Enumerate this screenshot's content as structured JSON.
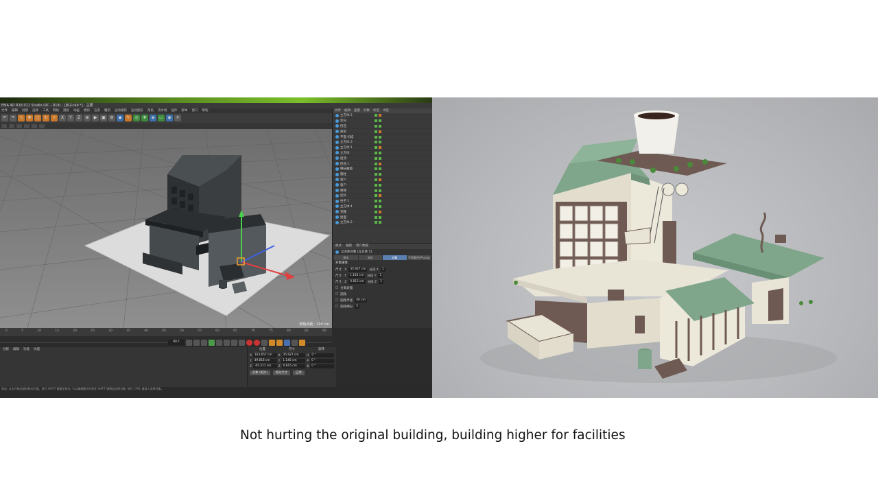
{
  "caption": "Not hurting the original building, building higher for facilities",
  "left_photo": {
    "window_title": "EMA 4D R18.011 Studio (RC - R18) - [房子c4d *] - 主要",
    "menu_items": [
      "文件",
      "编辑",
      "创建",
      "选择",
      "工具",
      "网格",
      "捕捉",
      "动画",
      "模拟",
      "渲染",
      "雕刻",
      "运动跟踪",
      "运动图形",
      "角色",
      "流水线",
      "插件",
      "脚本",
      "窗口",
      "帮助"
    ],
    "object_manager_tabs": [
      "文件",
      "编辑",
      "查看",
      "对象",
      "标签",
      "书签"
    ],
    "objects": [
      "立方体.5",
      "空白",
      "挤压",
      "矩形",
      "平面 扫描",
      "立方体.3",
      "立方体.1",
      "立方体",
      "屋顶",
      "挤压.1",
      "细分曲面",
      "圆柱",
      "窗户",
      "窗户",
      "楼梯",
      "栏杆",
      "柱子.1",
      "立方体.4",
      "克隆",
      "屋面",
      "立方体.2"
    ],
    "attr_tabs_head": [
      "模式",
      "编辑",
      "用户数据"
    ],
    "attr_object_title": "立方体对象 [立方体.5]",
    "attr_tabs": [
      "基本",
      "坐标",
      "对象",
      "平滑着色(Phong)"
    ],
    "attr_section": "对象属性",
    "attr_rows": [
      {
        "label": "尺寸 . X",
        "value": "35.927 cm",
        "seg_label": "分段 X",
        "seg": "1"
      },
      {
        "label": "尺寸 . Y",
        "value": "1.146 cm",
        "seg_label": "分段 Y",
        "seg": "1"
      },
      {
        "label": "尺寸 . Z",
        "value": "0.815 cm",
        "seg_label": "分段 Z",
        "seg": "1"
      }
    ],
    "attr_options": [
      "分离表面",
      "圆角",
      "圆角半径",
      "圆角细分"
    ],
    "attr_option_values": [
      "40 cm",
      "5"
    ],
    "viewport_label": "网格间距 : 100 cm",
    "timeline_ticks": [
      "0",
      "5",
      "10",
      "15",
      "20",
      "25",
      "30",
      "35",
      "40",
      "45",
      "50",
      "55",
      "60",
      "65",
      "70",
      "75",
      "80",
      "85",
      "90"
    ],
    "frame_field": "90 F",
    "frame_current": "0 F",
    "material_tabs": [
      "创建",
      "编辑",
      "功能",
      "纹理"
    ],
    "coord_headers": [
      "位置",
      "尺寸",
      "旋转"
    ],
    "coord_rows": [
      {
        "axis": "X",
        "pos": "163.657 cm",
        "size": "35.927 cm",
        "rot_axis": "H",
        "rot": "0 °"
      },
      {
        "axis": "Y",
        "pos": "49.818 cm",
        "size": "1.146 cm",
        "rot_axis": "P",
        "rot": "0 °"
      },
      {
        "axis": "Z",
        "pos": "-65.211 cm",
        "size": "0.815 cm",
        "rot_axis": "B",
        "rot": "0 °"
      }
    ],
    "coord_buttons": [
      "对象 (相对)",
      "绝对尺寸",
      "应用"
    ],
    "status_text": "移动: 点击并拖动鼠标移动元素。按住 SHIFT 键量化移动; 节点编辑模式时按住 SHIFT 键增加选择对象; 按住 CTRL 键减少选择对象。"
  },
  "colors": {
    "roof_green": "#7fa68a",
    "wall_cream": "#e8e4d6",
    "wood_brown": "#6e5a52",
    "c4d_grey": "#3a3a3a",
    "c4d_accent": "#5a7fb0"
  }
}
